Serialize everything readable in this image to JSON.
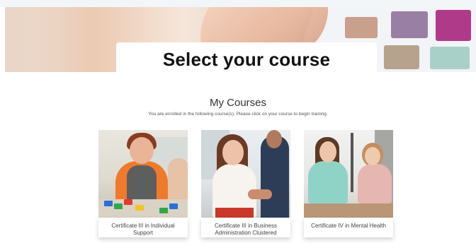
{
  "hero": {
    "title": "Select your course"
  },
  "courses_section": {
    "title": "My Courses",
    "subtitle": "You are enrolled in the following course(s). Please click on your course to begin training."
  },
  "courses": [
    {
      "name": "Certificate III in Individual Support",
      "photo_icon": "carer-with-client-photo"
    },
    {
      "name": "Certificate III in Business Administration Clustered",
      "photo_icon": "business-handshake-photo"
    },
    {
      "name": "Certificate IV in Mental Health",
      "photo_icon": "counselling-session-photo"
    }
  ]
}
